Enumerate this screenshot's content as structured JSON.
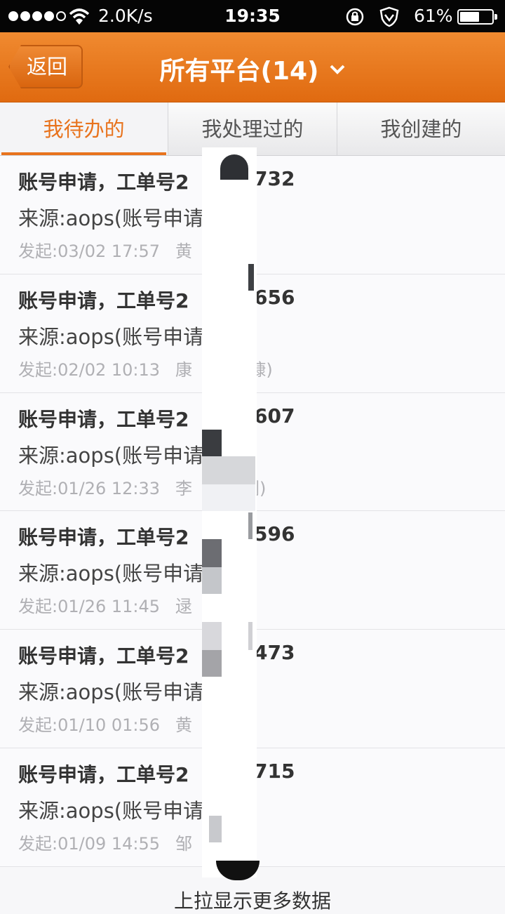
{
  "status_bar": {
    "network_speed": "2.0K/s",
    "time": "19:35",
    "battery_percent": "61%",
    "battery_level": 0.61
  },
  "nav": {
    "back_label": "返回",
    "title": "所有平台(14)"
  },
  "tabs": [
    {
      "label": "我待办的",
      "active": true
    },
    {
      "label": "我处理过的",
      "active": false
    },
    {
      "label": "我创建的",
      "active": false
    }
  ],
  "items": [
    {
      "title": "账号申请，工单号2",
      "title_suffix": "732",
      "source": "来源:aops(账号申请",
      "time": "发起:03/02 17:57",
      "person": "黄",
      "person_suffix": ""
    },
    {
      "title": "账号申请，工单号2",
      "title_suffix": "656",
      "source": "来源:aops(账号申请",
      "time": "发起:02/02 10:13",
      "person": "康",
      "person_suffix": "(慷)"
    },
    {
      "title": "账号申请，工单号2",
      "title_suffix": "607",
      "source": "来源:aops(账号申请",
      "time": "发起:01/26 12:33",
      "person": "李",
      "person_suffix": "刚)"
    },
    {
      "title": "账号申请，工单号2",
      "title_suffix": "596",
      "source": "来源:aops(账号申请",
      "time": "发起:01/26 11:45",
      "person": "逯",
      "person_suffix": ""
    },
    {
      "title": "账号申请，工单号2",
      "title_suffix": "473",
      "source": "来源:aops(账号申请",
      "time": "发起:01/10 01:56",
      "person": "黄",
      "person_suffix": ""
    },
    {
      "title": "账号申请，工单号2",
      "title_suffix": "715",
      "source": "来源:aops(账号申请",
      "time": "发起:01/09 14:55",
      "person": "邹",
      "person_suffix": ""
    }
  ],
  "footer": {
    "hint": "上拉显示更多数据"
  }
}
